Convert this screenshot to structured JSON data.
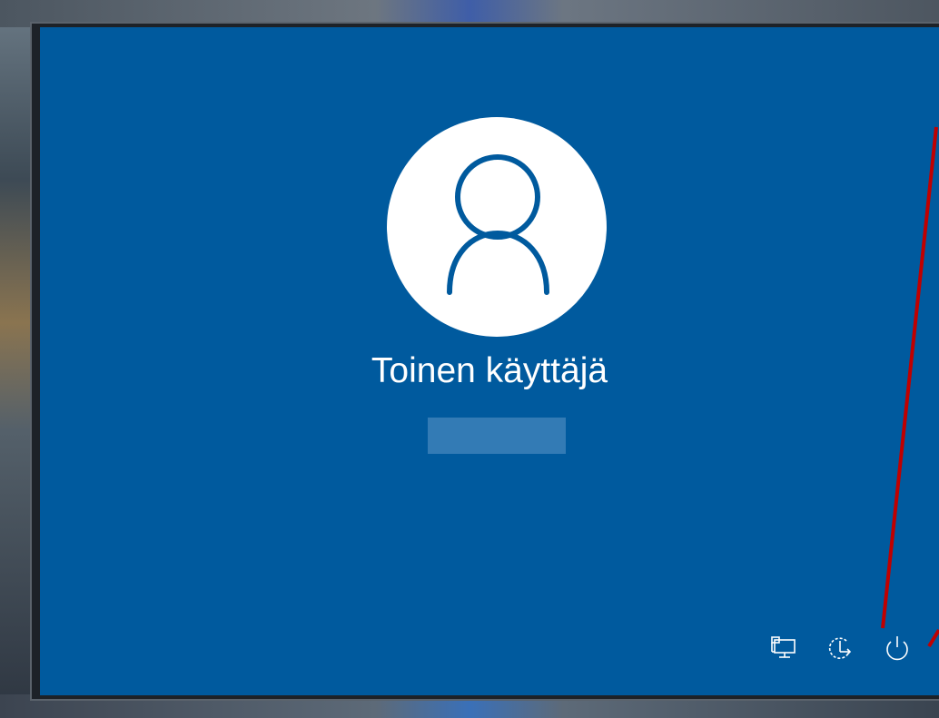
{
  "login_screen": {
    "user_name": "Toinen käyttäjä",
    "signin_button_label": ""
  },
  "bottom_bar": {
    "icons": [
      "network-icon",
      "ease-of-access-icon",
      "power-icon"
    ]
  },
  "colors": {
    "background": "#005a9e",
    "avatar_fill": "#ffffff",
    "avatar_stroke": "#005a9e",
    "signin_button": "#337bb5",
    "annotation": "#c00000"
  }
}
